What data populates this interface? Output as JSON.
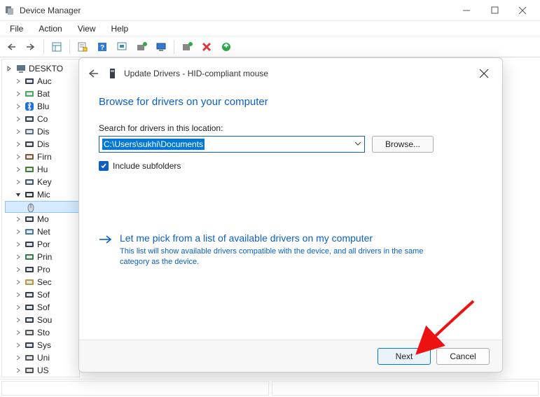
{
  "titlebar": {
    "title": "Device Manager"
  },
  "menubar": {
    "items": [
      "File",
      "Action",
      "View",
      "Help"
    ]
  },
  "tree": {
    "root": "DESKTO",
    "items": [
      {
        "label": "Auc",
        "color": "#3a404a"
      },
      {
        "label": "Bat",
        "color": "#4aa860"
      },
      {
        "label": "Blu",
        "color": "#1e6fd8",
        "bluetooth": true
      },
      {
        "label": "Co",
        "color": "#3a404a"
      },
      {
        "label": "Dis",
        "color": "#5f6f7d"
      },
      {
        "label": "Dis",
        "color": "#3a404a"
      },
      {
        "label": "Firn",
        "color": "#7a5a3a"
      },
      {
        "label": "Hu",
        "color": "#4a7a3a"
      },
      {
        "label": "Key",
        "color": "#495666"
      },
      {
        "label": "Mic",
        "color": "#333",
        "expanded": true
      }
    ],
    "selectedChild": "",
    "afterExpanded": [
      {
        "label": "Mo",
        "color": "#3a404a"
      },
      {
        "label": "Net",
        "color": "#4a7a9a"
      },
      {
        "label": "Por",
        "color": "#3a404a"
      },
      {
        "label": "Prin",
        "color": "#3a7a4a"
      },
      {
        "label": "Pro",
        "color": "#3a404a"
      },
      {
        "label": "Sec",
        "color": "#b79a3a"
      },
      {
        "label": "Sof",
        "color": "#3a404a"
      },
      {
        "label": "Sof",
        "color": "#3a404a"
      },
      {
        "label": "Sou",
        "color": "#3a404a"
      },
      {
        "label": "Sto",
        "color": "#555"
      },
      {
        "label": "Sys",
        "color": "#3a404a"
      },
      {
        "label": "Uni",
        "color": "#555"
      },
      {
        "label": "US",
        "color": "#555"
      }
    ]
  },
  "dialog": {
    "title": "Update Drivers - HID-compliant mouse",
    "heading": "Browse for drivers on your computer",
    "path_label": "Search for drivers in this location:",
    "path_value": "C:\\Users\\sukhi\\Documents",
    "browse_label": "Browse...",
    "include_subfolders_label": "Include subfolders",
    "pick_title": "Let me pick from a list of available drivers on my computer",
    "pick_desc": "This list will show available drivers compatible with the device, and all drivers in the same category as the device.",
    "next_label": "Next",
    "cancel_label": "Cancel"
  }
}
